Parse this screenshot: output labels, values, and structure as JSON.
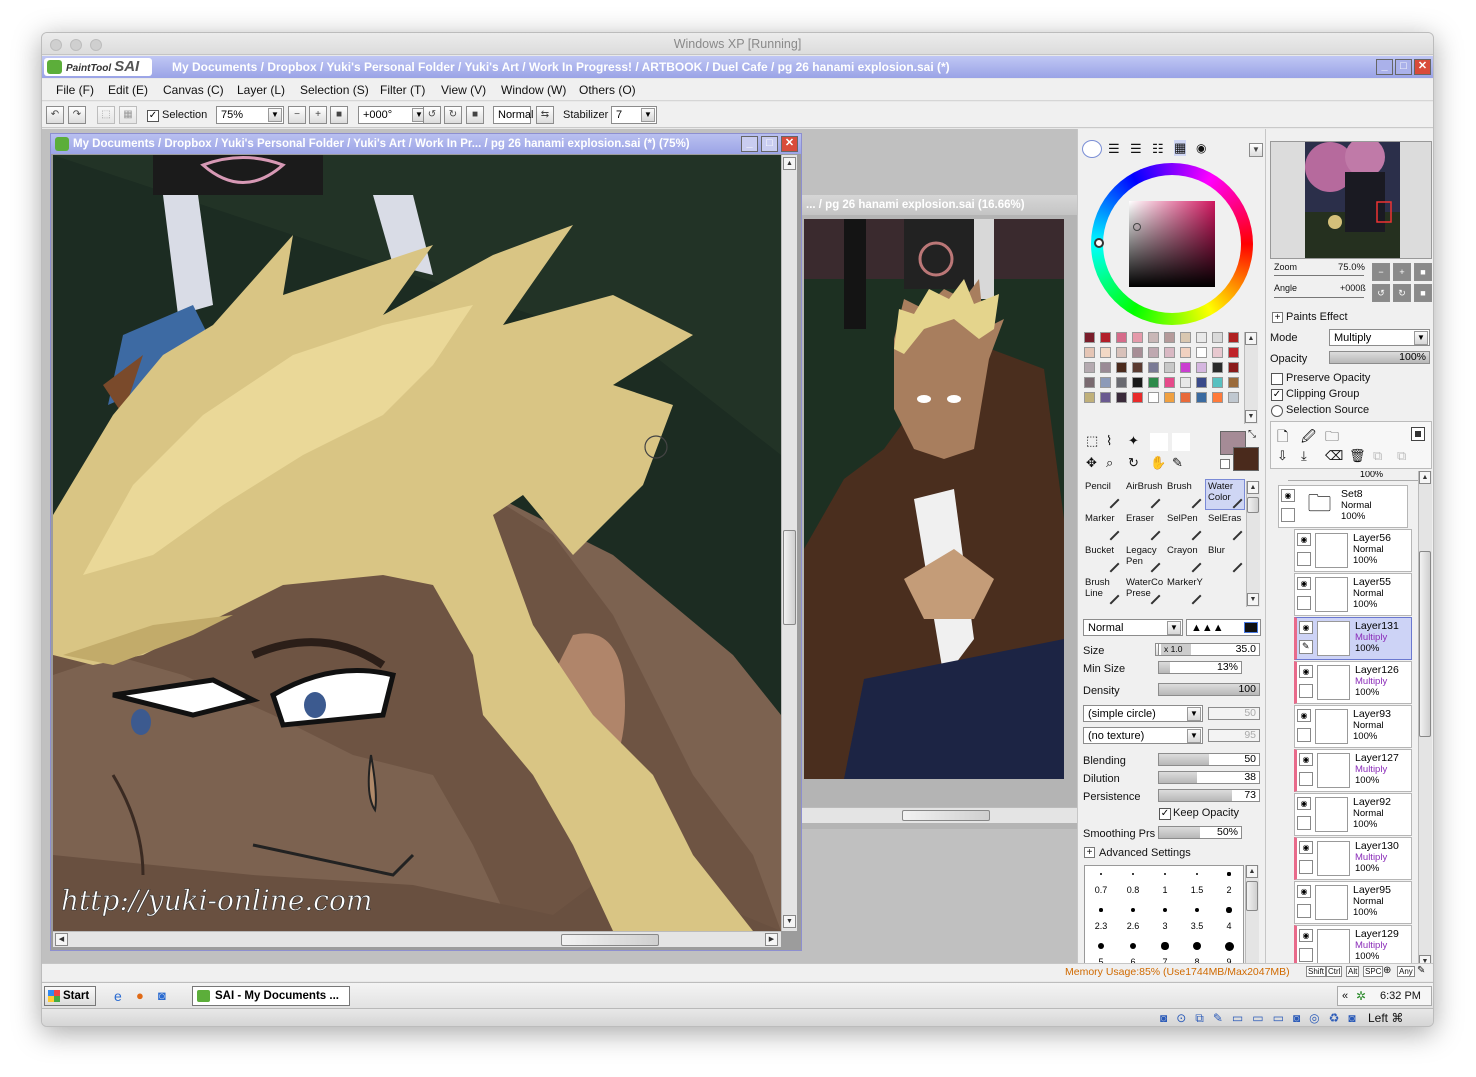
{
  "host": {
    "title": "Windows XP [Running]"
  },
  "app": {
    "logo_small": "PaintTool",
    "logo_big": "SAI",
    "title": "My Documents / Dropbox / Yuki's Personal Folder / Yuki's Art / Work In Progress! / ARTBOOK / Duel Cafe / pg 26 hanami explosion.sai (*)"
  },
  "menu": [
    "File (F)",
    "Edit (E)",
    "Canvas (C)",
    "Layer (L)",
    "Selection (S)",
    "Filter (T)",
    "View (V)",
    "Window (W)",
    "Others (O)"
  ],
  "toolbar": {
    "selection_label": "Selection",
    "zoom": "75%",
    "angle": "+000°",
    "mode": "Normal",
    "stabilizer_label": "Stabilizer",
    "stabilizer": "7"
  },
  "doc1": {
    "title": "My Documents / Dropbox / Yuki's Personal Folder / Yuki's Art / Work In Pr... / pg 26 hanami explosion.sai (*) (75%)",
    "watermark": "http://yuki-online.com"
  },
  "doc2": {
    "title": "... / pg 26 hanami explosion.sai (16.66%)"
  },
  "brush": {
    "blend_mode": "Normal",
    "size_label": "Size",
    "size_mult": "x 1.0",
    "size": "35.0",
    "minsize_label": "Min Size",
    "minsize": "13%",
    "minsize_pct": 13,
    "density_label": "Density",
    "density": "100",
    "density_pct": 100,
    "shape": "(simple circle)",
    "shape_val": "50",
    "texture": "(no texture)",
    "texture_val": "95",
    "blending_label": "Blending",
    "blending": "50",
    "blending_pct": 50,
    "dilution_label": "Dilution",
    "dilution": "38",
    "dilution_pct": 38,
    "persistence_label": "Persistence",
    "persistence": "73",
    "persistence_pct": 73,
    "keep_opacity": "Keep Opacity",
    "smoothing_label": "Smoothing Prs",
    "smoothing": "50%",
    "smoothing_pct": 50,
    "advanced": "Advanced Settings"
  },
  "tools": [
    {
      "l1": "Pencil",
      "l2": ""
    },
    {
      "l1": "AirBrush",
      "l2": ""
    },
    {
      "l1": "Brush",
      "l2": ""
    },
    {
      "l1": "Water",
      "l2": "Color"
    },
    {
      "l1": "Marker",
      "l2": ""
    },
    {
      "l1": "Eraser",
      "l2": ""
    },
    {
      "l1": "SelPen",
      "l2": ""
    },
    {
      "l1": "SelEras",
      "l2": ""
    },
    {
      "l1": "Bucket",
      "l2": ""
    },
    {
      "l1": "Legacy",
      "l2": "Pen"
    },
    {
      "l1": "Crayon",
      "l2": ""
    },
    {
      "l1": "Blur",
      "l2": ""
    },
    {
      "l1": "Brush",
      "l2": "Line"
    },
    {
      "l1": "WaterCo",
      "l2": "Prese"
    },
    {
      "l1": "MarkerY",
      "l2": ""
    }
  ],
  "brush_sizes": [
    "0.7",
    "0.8",
    "1",
    "1.5",
    "2",
    "2.3",
    "2.6",
    "3",
    "3.5",
    "4",
    "5",
    "6",
    "7",
    "8",
    "9"
  ],
  "navigator": {
    "zoom_label": "Zoom",
    "zoom": "75.0%",
    "angle_label": "Angle",
    "angle": "+000ß"
  },
  "layer_props": {
    "paints_effect": "Paints Effect",
    "mode_label": "Mode",
    "mode": "Multiply",
    "opacity_label": "Opacity",
    "opacity": "100%",
    "preserve_opacity": "Preserve Opacity",
    "clipping_group": "Clipping Group",
    "selection_source": "Selection Source"
  },
  "layers": [
    {
      "name": "Set8",
      "mode": "Normal",
      "opacity": "100%",
      "type": "set"
    },
    {
      "name": "Layer56",
      "mode": "Normal",
      "opacity": "100%"
    },
    {
      "name": "Layer55",
      "mode": "Normal",
      "opacity": "100%"
    },
    {
      "name": "Layer131",
      "mode": "Multiply",
      "opacity": "100%",
      "selected": true
    },
    {
      "name": "Layer126",
      "mode": "Multiply",
      "opacity": "100%"
    },
    {
      "name": "Layer93",
      "mode": "Normal",
      "opacity": "100%"
    },
    {
      "name": "Layer127",
      "mode": "Multiply",
      "opacity": "100%"
    },
    {
      "name": "Layer92",
      "mode": "Normal",
      "opacity": "100%"
    },
    {
      "name": "Layer130",
      "mode": "Multiply",
      "opacity": "100%"
    },
    {
      "name": "Layer95",
      "mode": "Normal",
      "opacity": "100%"
    },
    {
      "name": "Layer129",
      "mode": "Multiply",
      "opacity": "100%"
    }
  ],
  "layer_top_partial": "100%",
  "status": {
    "memory": "Memory Usage:85% (Use1744MB/Max2047MB)",
    "keys": [
      "Shift",
      "Ctrl",
      "Alt",
      "SPC",
      "Any"
    ]
  },
  "taskbar": {
    "start": "Start",
    "task": "SAI - My Documents ...",
    "time": "6:32 PM"
  },
  "vbox": {
    "hostkey": "Left ⌘"
  },
  "colors": {
    "title_blue": "#9aa3e6",
    "main_color": "#a58b96",
    "sub_color": "#4a2a1c",
    "multiply_purple": "#8a2bb8"
  }
}
